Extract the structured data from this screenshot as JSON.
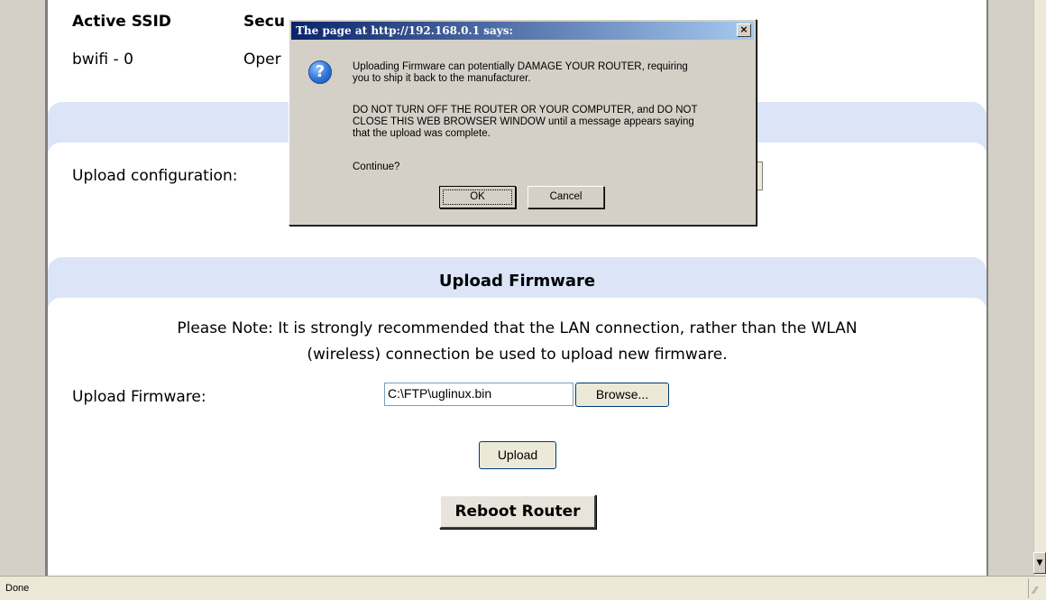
{
  "status": {
    "text": "Done"
  },
  "ssid_table": {
    "headers": [
      "Active SSID",
      "Secu"
    ],
    "row": [
      "bwifi - 0",
      "Oper"
    ]
  },
  "config": {
    "label": "Upload configuration:"
  },
  "firmware": {
    "section_title": "Upload Firmware",
    "note_line1": "Please Note: It is strongly recommended that the LAN connection, rather than the WLAN",
    "note_line2": "(wireless) connection be used to upload new firmware.",
    "field_label": "Upload Firmware:",
    "file_value": "C:\\FTP\\uglinux.bin",
    "browse_label": "Browse...",
    "upload_label": "Upload",
    "reboot_label": "Reboot Router"
  },
  "dialog": {
    "title": "The page at http://192.168.0.1 says:",
    "close_glyph": "×",
    "icon": "question-icon",
    "lines": [
      "Uploading Firmware can potentially DAMAGE YOUR ROUTER, requiring",
      "you to ship it back to the manufacturer.",
      "DO NOT TURN OFF THE ROUTER OR YOUR COMPUTER, and DO NOT",
      "CLOSE THIS WEB BROWSER WINDOW until a message appears saying",
      "that the upload was complete.",
      "Continue?"
    ],
    "ok_label": "OK",
    "cancel_label": "Cancel"
  },
  "colors": {
    "section_band": "#dbe5f7",
    "title_bar_start": "#0a246a",
    "title_bar_end": "#a6caf0"
  }
}
